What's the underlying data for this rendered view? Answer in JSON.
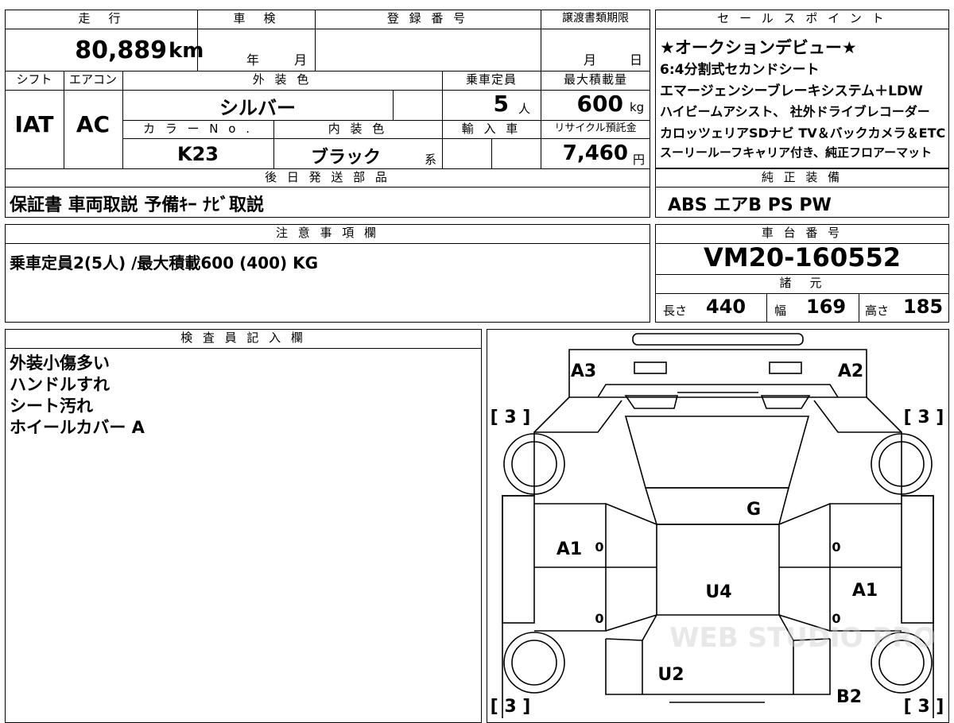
{
  "top_labels": {
    "mileage": "走　行",
    "inspection": "車　検",
    "registration": "登 録 番 号",
    "transfer_deadline": "譲渡書類期限",
    "sales_point": "セ ー ル ス ポ イ ン ト",
    "shift": "シフト",
    "aircon": "エアコン",
    "exterior_color": "外 装 色",
    "capacity": "乗車定員",
    "max_load": "最大積載量",
    "color_no": "カ ラ ー N o .",
    "interior_color": "内 装 色",
    "import": "輸 入 車",
    "recycle": "リサイクル預託金",
    "later_parts": "後 日 発 送 部 品",
    "genuine_equipment": "純 正 装 備",
    "notes": "注 意 事 項 欄",
    "chassis_no": "車 台 番 号",
    "specs": "諸　元",
    "inspector": "検 査 員 記 入 欄"
  },
  "vehicle": {
    "mileage": "80,889",
    "mileage_unit": "km",
    "inspection_year": "年",
    "inspection_month": "月",
    "transfer_month": "月",
    "transfer_day": "日",
    "shift": "IAT",
    "aircon": "AC",
    "exterior_color": "シルバー",
    "capacity": "5",
    "capacity_unit": "人",
    "max_load": "600",
    "max_load_unit": "kg",
    "color_no": "K23",
    "interior_color": "ブラック",
    "interior_suffix": "系",
    "recycle_fee": "7,460",
    "recycle_unit": "円",
    "chassis_no": "VM20-160552",
    "length_label": "長さ",
    "length": "440",
    "width_label": "幅",
    "width": "169",
    "height_label": "高さ",
    "height": "185"
  },
  "sales_points": [
    "★オークションデビュー★",
    "6:4分割式セカンドシート",
    "エマージェンシーブレーキシステム＋LDW",
    "ハイビームアシスト、 社外ドライブレコーダー",
    "カロッツェリアSDナビ TV＆バックカメラ＆ETC",
    "スーリールーフキャリア付き、純正フロアーマット"
  ],
  "later_parts": "保証書 車両取説 予備ｷｰ ﾅﾋﾞ取説",
  "genuine_equipment": "ABS エアB PS PW",
  "notes": "乗車定員2(5人) /最大積載600 (400) KG",
  "inspector_notes": [
    "外装小傷多い",
    "ハンドルすれ",
    "シート汚れ",
    "ホイールカバー A"
  ],
  "diagram_marks": {
    "front_left": "A3",
    "front_right": "A2",
    "bracket_tl": "[ 3 ]",
    "bracket_tr": "[ 3 ]",
    "bracket_bl": "[ 3 ]",
    "bracket_br": "[ 3 ]",
    "windshield": "G",
    "left_door": "A1",
    "right_door": "A1",
    "roof": "U4",
    "rear_body": "U2",
    "rear_right": "B2",
    "zero": "0"
  },
  "watermark": "WEB STUDIO PRO"
}
